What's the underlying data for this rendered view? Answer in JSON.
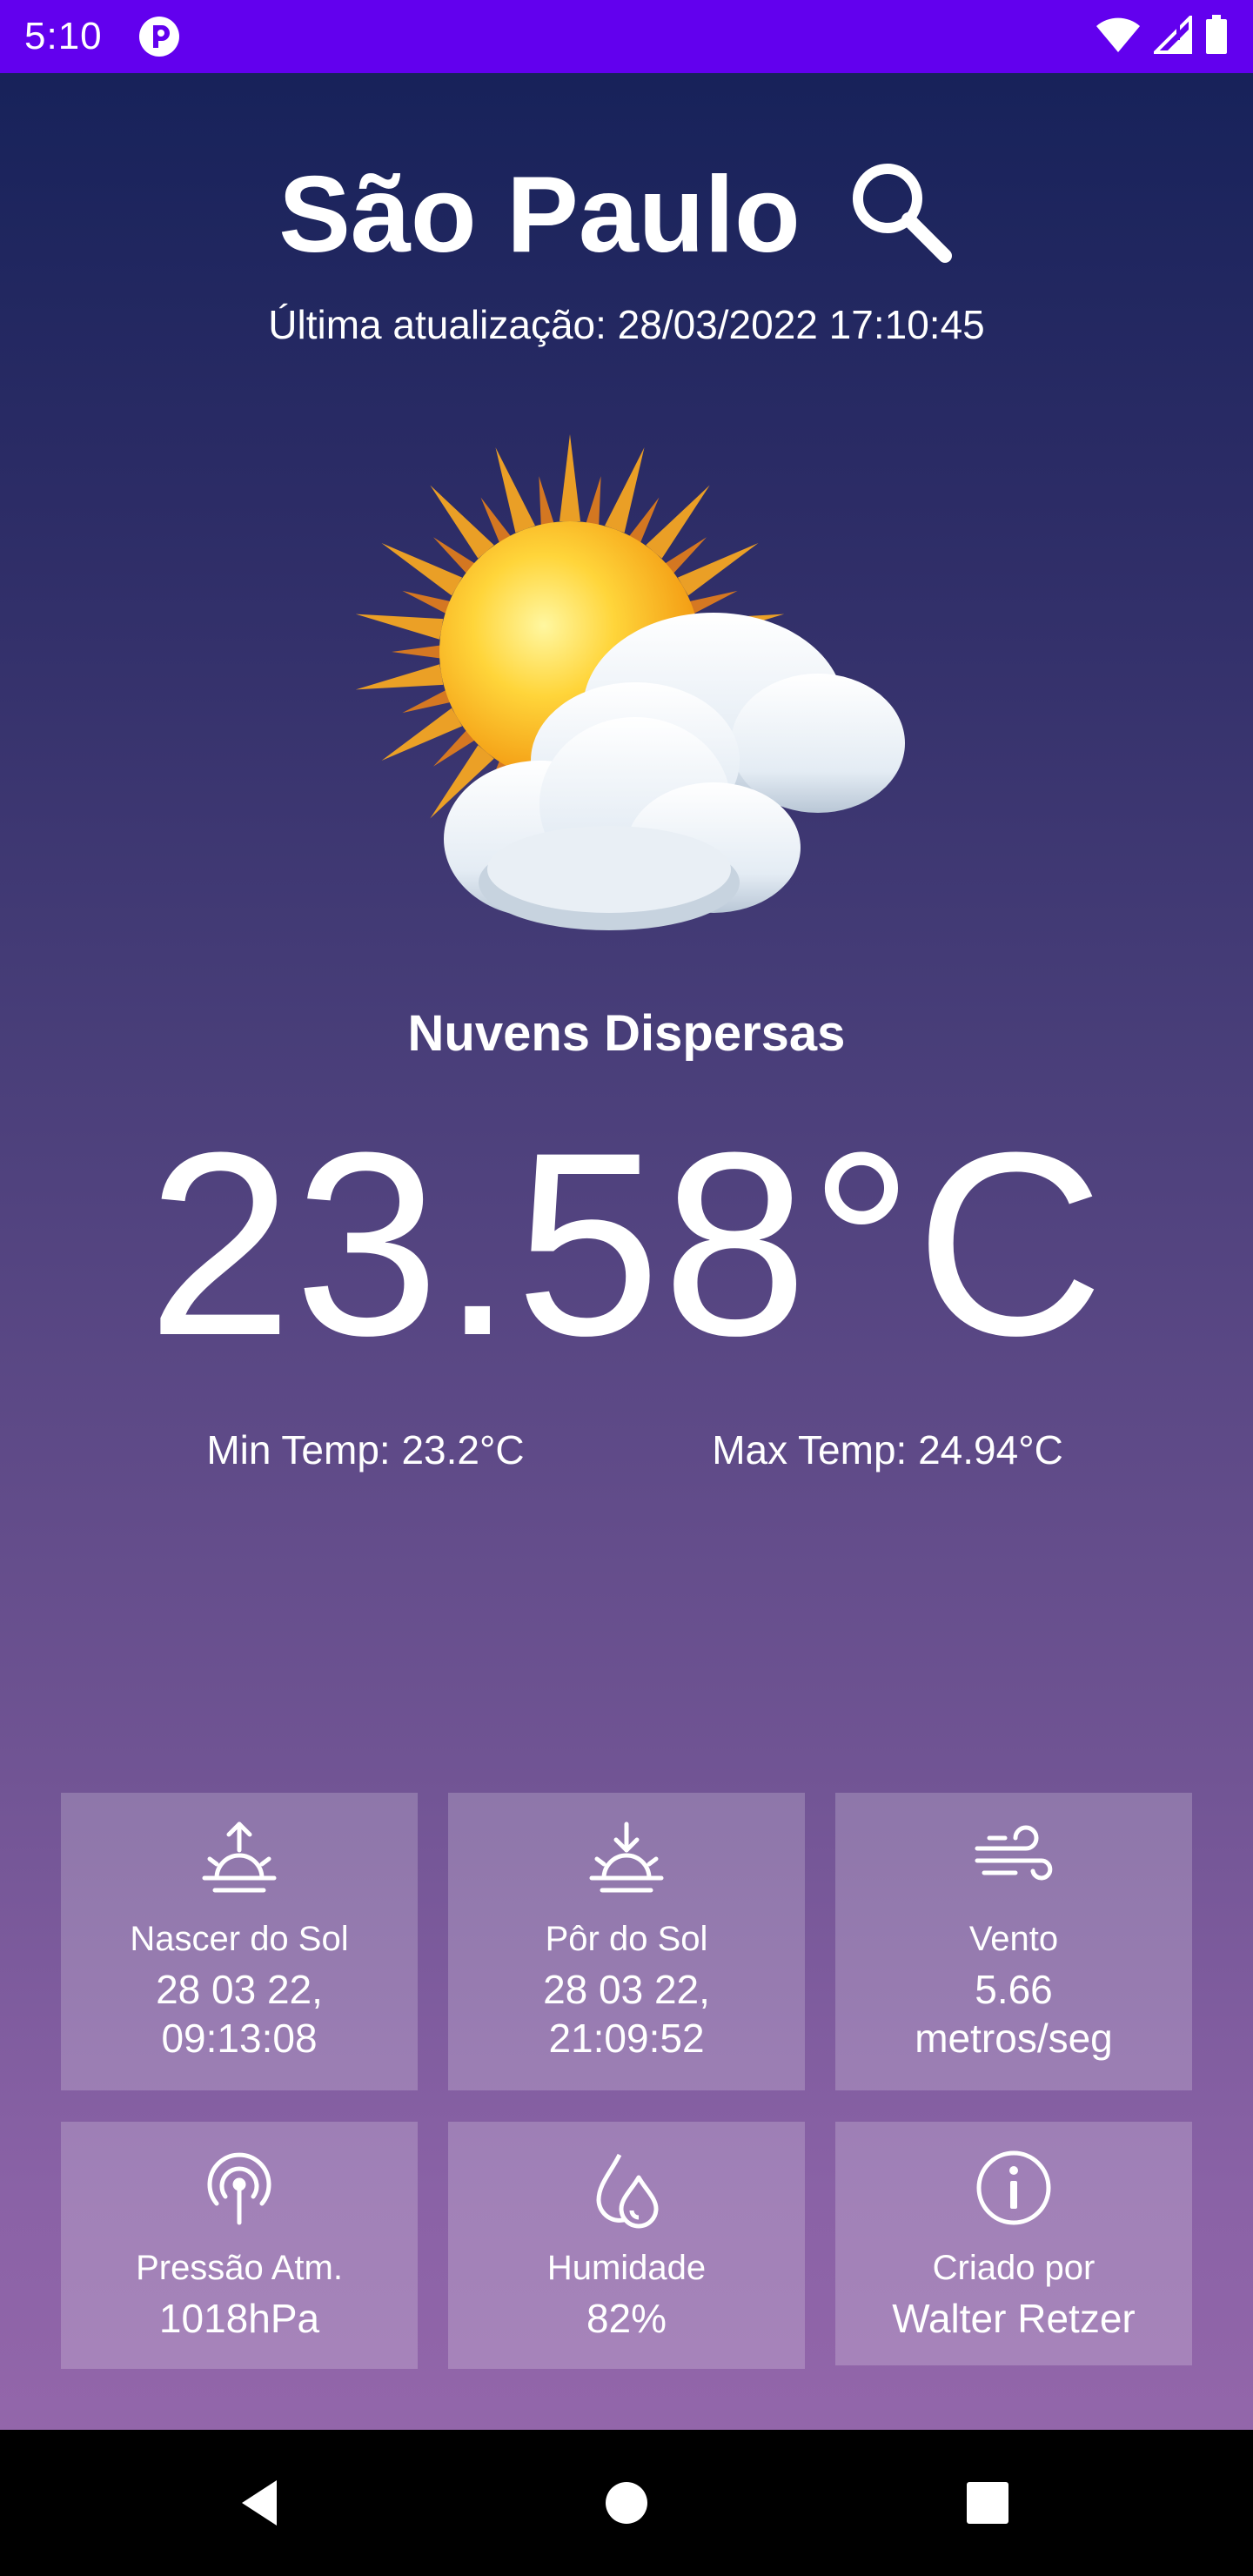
{
  "status_bar": {
    "time": "5:10",
    "icons": [
      "app-notification-icon",
      "wifi-icon",
      "cellular-icon",
      "battery-icon"
    ]
  },
  "header": {
    "city": "São Paulo",
    "search_icon": "search-icon",
    "updated": "Última atualização: 28/03/2022 17:10:45"
  },
  "current": {
    "icon": "partly-cloudy-icon",
    "description": "Nuvens Dispersas",
    "temperature": "23.58°C",
    "min_temp": "Min Temp: 23.2°C",
    "max_temp": "Max Temp: 24.94°C"
  },
  "tiles": [
    {
      "icon": "sunrise-icon",
      "label": "Nascer do Sol",
      "value_line1": "28 03 22,",
      "value_line2": "09:13:08"
    },
    {
      "icon": "sunset-icon",
      "label": "Pôr do Sol",
      "value_line1": "28 03 22,",
      "value_line2": "21:09:52"
    },
    {
      "icon": "wind-icon",
      "label": "Vento",
      "value_line1": "5.66",
      "value_line2": "metros/seg"
    },
    {
      "icon": "pressure-icon",
      "label": "Pressão Atm.",
      "value_line1": "1018hPa"
    },
    {
      "icon": "humidity-icon",
      "label": "Humidade",
      "value_line1": "82%"
    },
    {
      "icon": "info-icon",
      "label": "Criado por",
      "value_line1": "Walter Retzer"
    }
  ],
  "nav_bar": {
    "buttons": [
      "back-icon",
      "home-icon",
      "recents-icon"
    ]
  },
  "colors": {
    "status_bar": "#6200EE",
    "gradient_top": "#17225a",
    "gradient_bottom": "#9366aa",
    "text": "#ffffff"
  }
}
